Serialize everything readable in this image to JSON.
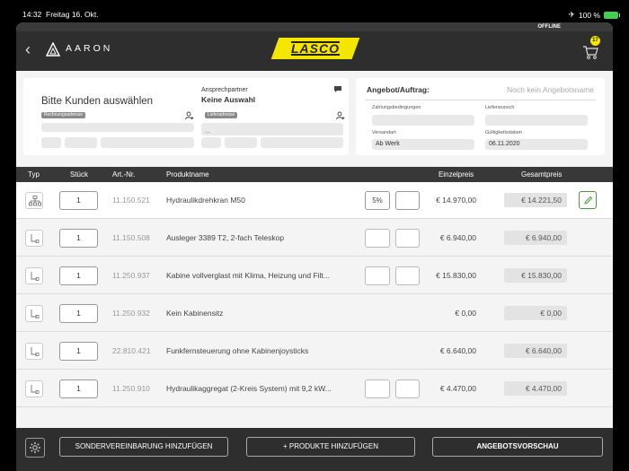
{
  "status_bar": {
    "time": "14:32",
    "date": "Freitag 16. Okt.",
    "battery": "100 %"
  },
  "offline_label": "OFFLINE",
  "header": {
    "app_name": "AARON",
    "brand": "LASCO",
    "cart_count": "17"
  },
  "customer": {
    "title": "Bitte Kunden auswählen",
    "billing_tag": "Rechnungsadresse",
    "contact_label": "Ansprechpartner",
    "contact_value": "Keine Auswahl",
    "delivery_tag": "Lieferadresse",
    "delivery_dots": "..."
  },
  "offer": {
    "title": "Angebot/Auftrag:",
    "value": "Noch kein Angebotsname",
    "payment_label": "Zahlungsbedingungen",
    "payment_value": "",
    "delivery_wish_label": "Lieferwunsch",
    "delivery_wish_value": "",
    "shipping_label": "Versandart",
    "shipping_value": "Ab Werk",
    "validity_label": "Gültigkeitsdatum",
    "validity_value": "06.11.2020"
  },
  "table": {
    "headers": {
      "typ": "Typ",
      "qty": "Stück",
      "art": "Art.-Nr.",
      "name": "Produktname",
      "unit": "Einzelpreis",
      "total": "Gesamtpreis"
    },
    "rows": [
      {
        "type": "hierarchy-icon",
        "qty": "1",
        "art": "11.150.521",
        "name": "Hydraulikdrehkran M50",
        "discount": "5%",
        "unit": "€ 14.970,00",
        "total": "€ 14.221,50"
      },
      {
        "type": "sub-item-icon",
        "qty": "1",
        "art": "11.150.508",
        "name": "Ausleger 3389 T2, 2-fach Teleskop",
        "discount": "",
        "unit": "€ 6.940,00",
        "total": "€ 6.940,00"
      },
      {
        "type": "sub-item-icon",
        "qty": "1",
        "art": "11.250.937",
        "name": "Kabine vollverglast mit Klima, Heizung und Filt...",
        "discount": "",
        "unit": "€ 15.830,00",
        "total": "€ 15.830,00"
      },
      {
        "type": "sub-item-icon",
        "qty": "1",
        "art": "11.250.932",
        "name": "Kein Kabinensitz",
        "discount": "",
        "unit": "€ 0,00",
        "total": "€ 0,00"
      },
      {
        "type": "sub-item-icon",
        "qty": "1",
        "art": "22.810.421",
        "name": "Funkfernsteuerung ohne Kabinenjoysticks",
        "discount": "",
        "unit": "€ 6.640,00",
        "total": "€ 6.640,00"
      },
      {
        "type": "sub-item-icon",
        "qty": "1",
        "art": "11.250.910",
        "name": "Hydraulikaggregat (2-Kreis System) mit 9,2 kW...",
        "discount": "",
        "unit": "€ 4.470,00",
        "total": "€ 4.470,00"
      }
    ]
  },
  "footer": {
    "special_button": "SONDERVEREINBARUNG HINZUFÜGEN",
    "add_products_button": "+ PRODUKTE HINZUFÜGEN",
    "preview_button": "ANGEBOTSVORSCHAU"
  }
}
